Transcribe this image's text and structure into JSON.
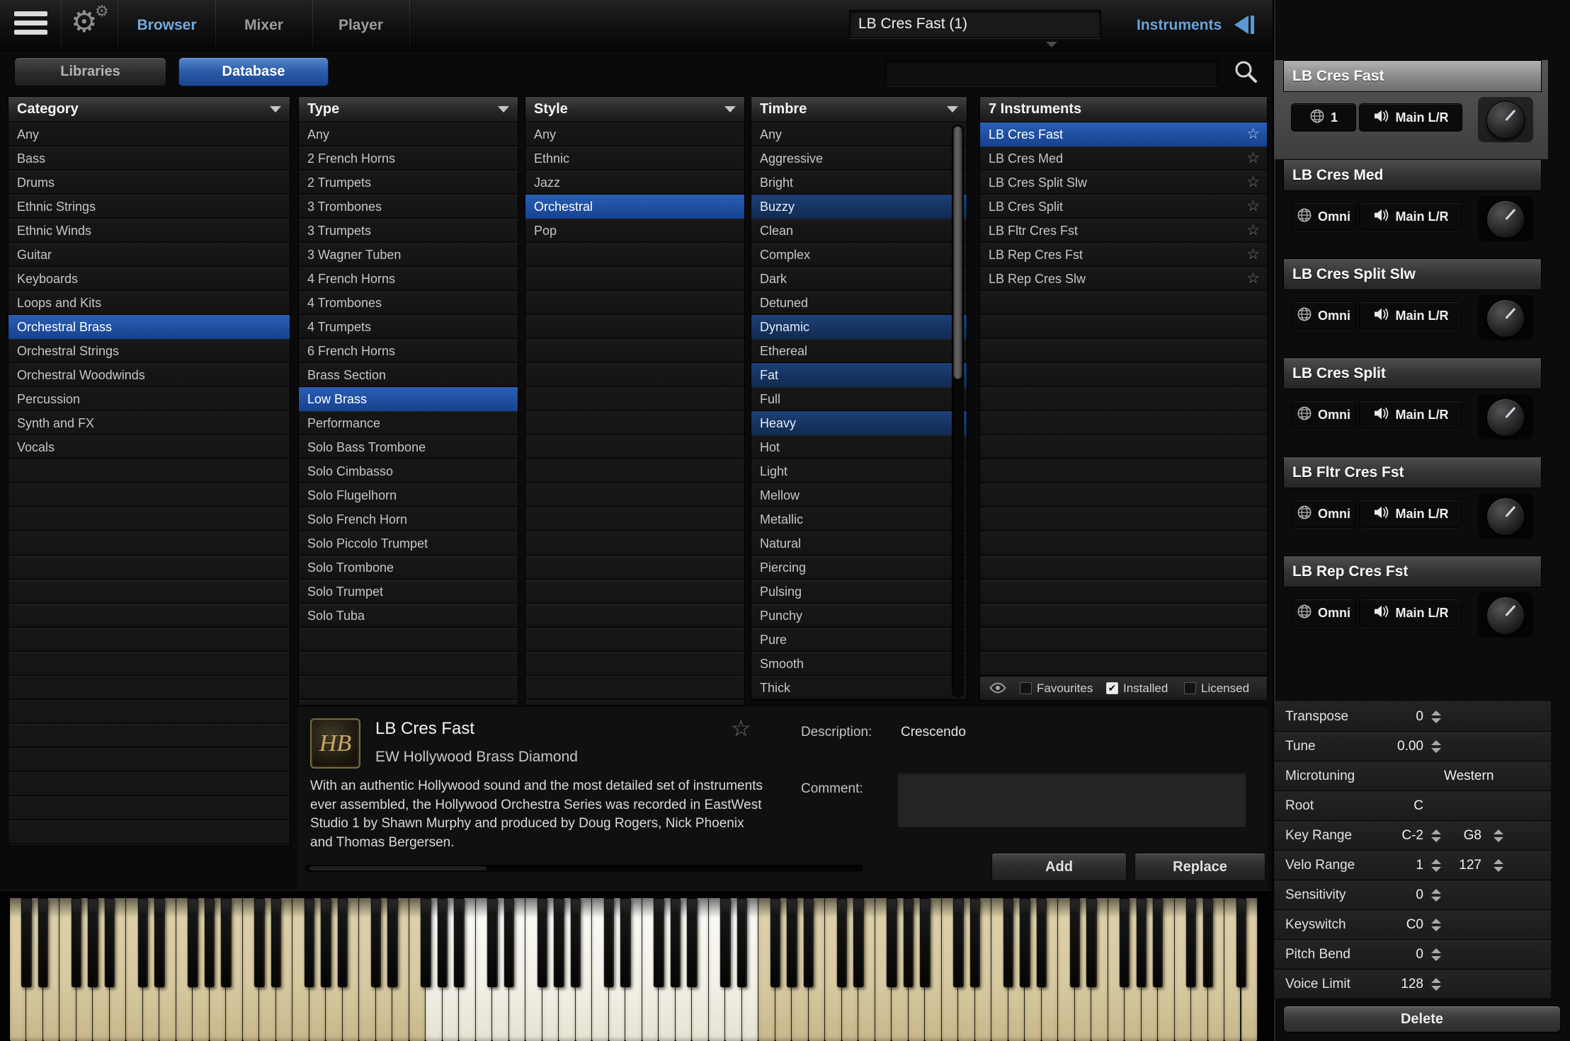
{
  "topbar": {
    "tabs": [
      {
        "label": "Browser",
        "active": true
      },
      {
        "label": "Mixer",
        "active": false
      },
      {
        "label": "Player",
        "active": false
      }
    ],
    "instrument_field_value": "LB Cres Fast (1)",
    "instruments_label": "Instruments"
  },
  "toolbar": {
    "libraries_label": "Libraries",
    "database_label": "Database",
    "search_value": ""
  },
  "columns": {
    "category": {
      "title": "Category",
      "items": [
        "Any",
        "Bass",
        "Drums",
        "Ethnic Strings",
        "Ethnic Winds",
        "Guitar",
        "Keyboards",
        "Loops and Kits",
        "Orchestral Brass",
        "Orchestral Strings",
        "Orchestral Woodwinds",
        "Percussion",
        "Synth and FX",
        "Vocals"
      ],
      "selected": [
        "Orchestral Brass"
      ]
    },
    "type": {
      "title": "Type",
      "items": [
        "Any",
        "2 French Horns",
        "2 Trumpets",
        "3 Trombones",
        "3 Trumpets",
        "3 Wagner Tuben",
        "4 French Horns",
        "4 Trombones",
        "4 Trumpets",
        "6 French Horns",
        "Brass Section",
        "Low Brass",
        "Performance",
        "Solo Bass Trombone",
        "Solo Cimbasso",
        "Solo Flugelhorn",
        "Solo French Horn",
        "Solo Piccolo Trumpet",
        "Solo Trombone",
        "Solo Trumpet",
        "Solo Tuba"
      ],
      "selected": [
        "Low Brass"
      ]
    },
    "style": {
      "title": "Style",
      "items": [
        "Any",
        "Ethnic",
        "Jazz",
        "Orchestral",
        "Pop"
      ],
      "selected": [
        "Orchestral"
      ]
    },
    "timbre": {
      "title": "Timbre",
      "items": [
        "Any",
        "Aggressive",
        "Bright",
        "Buzzy",
        "Clean",
        "Complex",
        "Dark",
        "Detuned",
        "Dynamic",
        "Ethereal",
        "Fat",
        "Full",
        "Heavy",
        "Hot",
        "Light",
        "Mellow",
        "Metallic",
        "Natural",
        "Piercing",
        "Pulsing",
        "Punchy",
        "Pure",
        "Smooth",
        "Thick"
      ],
      "selected": [
        "Buzzy",
        "Dynamic",
        "Fat",
        "Heavy"
      ]
    },
    "instruments": {
      "title": "7 Instruments",
      "items": [
        "LB Cres Fast",
        "LB Cres Med",
        "LB Cres Split Slw",
        "LB Cres Split",
        "LB Fltr Cres Fst",
        "LB Rep Cres Fst",
        "LB Rep Cres Slw"
      ],
      "selected": [
        "LB Cres Fast"
      ]
    }
  },
  "filter_bar": {
    "favourites": {
      "label": "Favourites",
      "checked": false
    },
    "installed": {
      "label": "Installed",
      "checked": true
    },
    "licensed": {
      "label": "Licensed",
      "checked": false
    }
  },
  "detail": {
    "logo_text": "HB",
    "title": "LB Cres Fast",
    "library": "EW Hollywood Brass Diamond",
    "blurb": "With an authentic Hollywood sound and the most detailed set of instruments ever assembled, the Hollywood Orchestra Series was recorded in EastWest Studio 1 by Shawn Murphy and produced by Doug Rogers, Nick Phoenix and Thomas Bergersen.",
    "description_label": "Description:",
    "description_value": "Crescendo",
    "comment_label": "Comment:",
    "comment_value": "",
    "add_label": "Add",
    "replace_label": "Replace"
  },
  "slots": [
    {
      "name": "LB Cres Fast",
      "channel": "1",
      "output": "Main L/R",
      "selected": true
    },
    {
      "name": "LB Cres Med",
      "channel": "Omni",
      "output": "Main L/R",
      "selected": false
    },
    {
      "name": "LB Cres Split Slw",
      "channel": "Omni",
      "output": "Main L/R",
      "selected": false
    },
    {
      "name": "LB Cres Split",
      "channel": "Omni",
      "output": "Main L/R",
      "selected": false
    },
    {
      "name": "LB Fltr Cres Fst",
      "channel": "Omni",
      "output": "Main L/R",
      "selected": false
    },
    {
      "name": "LB Rep Cres Fst",
      "channel": "Omni",
      "output": "Main L/R",
      "selected": false
    }
  ],
  "params": [
    {
      "label": "Transpose",
      "value": "0",
      "stepper": true
    },
    {
      "label": "Tune",
      "value": "0.00",
      "stepper": true
    },
    {
      "label": "Microtuning",
      "value2": "Western"
    },
    {
      "label": "Root",
      "value": "C"
    },
    {
      "label": "Key Range",
      "value": "C-2",
      "stepper": true,
      "value2": "G8",
      "stepper2": true
    },
    {
      "label": "Velo Range",
      "value": "1",
      "stepper": true,
      "value2": "127",
      "stepper2": true
    },
    {
      "label": "Sensitivity",
      "value": "0",
      "stepper": true
    },
    {
      "label": "Keyswitch",
      "value": "C0",
      "stepper": true
    },
    {
      "label": "Pitch Bend",
      "value": "0",
      "stepper": true
    },
    {
      "label": "Voice Limit",
      "value": "128",
      "stepper": true
    }
  ],
  "delete_label": "Delete",
  "keyboard": {
    "white_keys": 75,
    "highlight_start": 25,
    "highlight_end": 44
  },
  "colors": {
    "selection_blue": "#1d4f9c",
    "timbre_selection_blue": "#16355f",
    "accent_blue": "#74abe2",
    "database_button_blue": "#2a5aa8"
  }
}
